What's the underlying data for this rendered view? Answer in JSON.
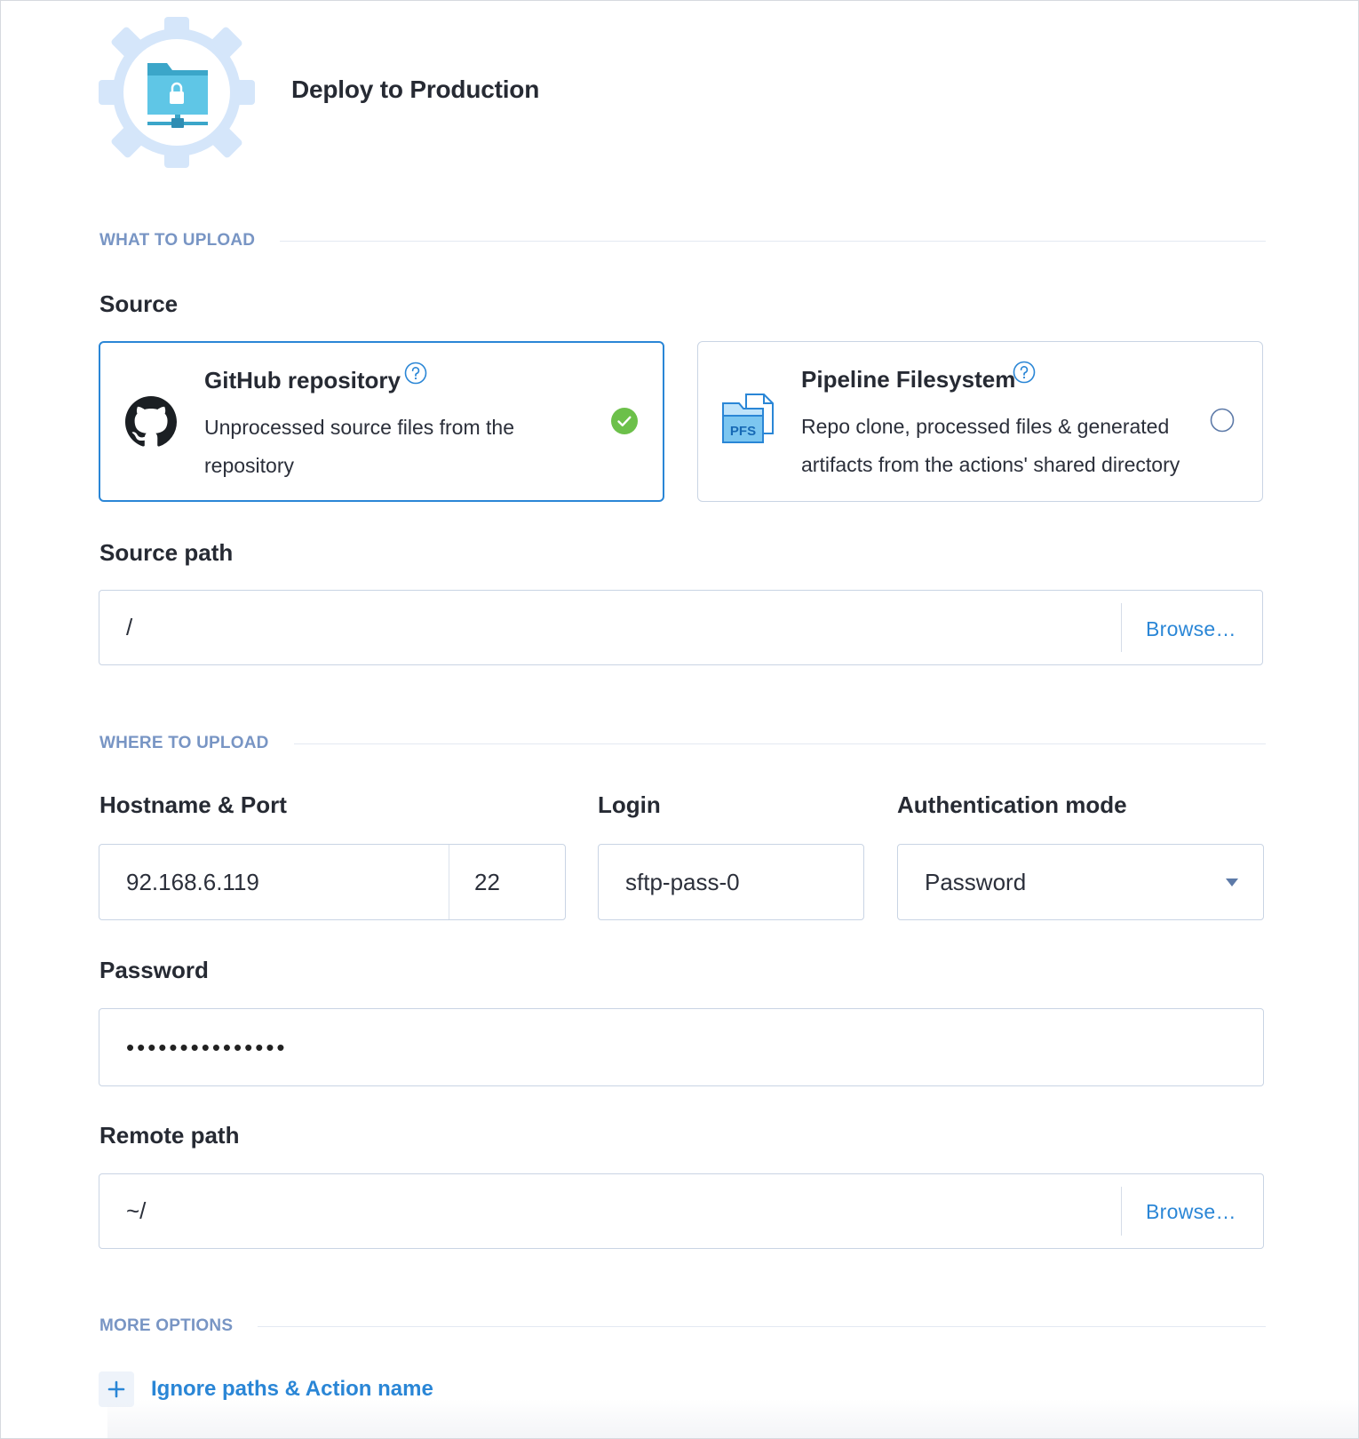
{
  "header": {
    "title": "Deploy to Production",
    "icon": "sftp-server-gear-icon"
  },
  "sections": {
    "what": "WHAT TO UPLOAD",
    "where": "WHERE TO UPLOAD",
    "more": "MORE OPTIONS"
  },
  "source": {
    "label": "Source",
    "options": [
      {
        "title": "GitHub repository",
        "description": "Unprocessed source files from the repository",
        "icon": "github-icon",
        "selected": true
      },
      {
        "title": "Pipeline Filesystem",
        "description": "Repo clone, processed files & generated artifacts from the actions' shared directory",
        "icon": "pfs-icon",
        "logo_text": "PFS",
        "selected": false
      }
    ]
  },
  "source_path": {
    "label": "Source path",
    "value": "/",
    "browse": "Browse…"
  },
  "hostname": {
    "label": "Hostname & Port",
    "host": "92.168.6.119",
    "port": "22"
  },
  "login": {
    "label": "Login",
    "value": "sftp-pass-0"
  },
  "auth_mode": {
    "label": "Authentication mode",
    "value": "Password"
  },
  "password": {
    "label": "Password",
    "masked": "•••••••••••••••"
  },
  "remote_path": {
    "label": "Remote path",
    "value": "~/",
    "browse": "Browse…"
  },
  "more_options": {
    "label": "Ignore paths & Action name"
  },
  "colors": {
    "accent": "#2a86d6",
    "section": "#7895c4",
    "success": "#6cc04a",
    "border": "#c9d4e4"
  }
}
